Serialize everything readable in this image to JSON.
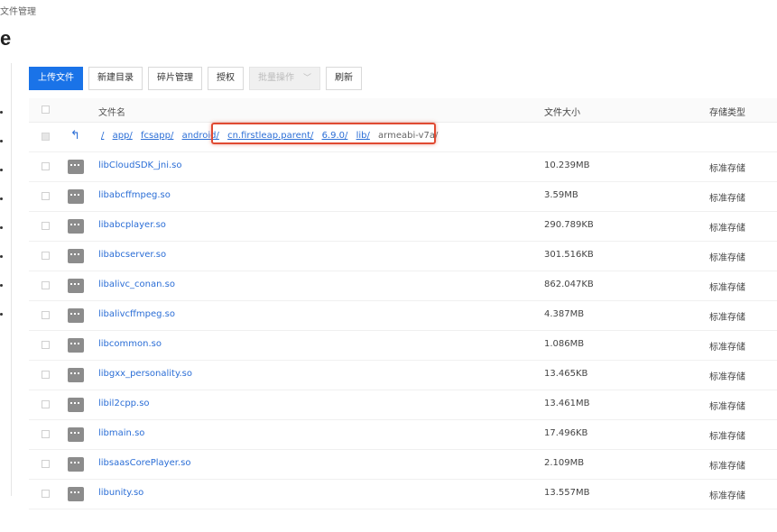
{
  "breadcrumb": "文件管理",
  "page_title_fragment": "e",
  "toolbar": {
    "upload": "上传文件",
    "new_dir": "新建目录",
    "fragments": "碎片管理",
    "authorize": "授权",
    "batch": "批量操作",
    "refresh": "刷新"
  },
  "columns": {
    "name": "文件名",
    "size": "文件大小",
    "type": "存储类型"
  },
  "path": {
    "segments": [
      "/",
      "app/",
      "fcsapp/",
      "android/",
      "cn.firstleap.parent/",
      "6.9.0/",
      "lib/"
    ],
    "current": "armeabi-v7a/"
  },
  "files": [
    {
      "name": "libCloudSDK_jni.so",
      "size": "10.239MB",
      "type": "标准存储"
    },
    {
      "name": "libabcffmpeg.so",
      "size": "3.59MB",
      "type": "标准存储"
    },
    {
      "name": "libabcplayer.so",
      "size": "290.789KB",
      "type": "标准存储"
    },
    {
      "name": "libabcserver.so",
      "size": "301.516KB",
      "type": "标准存储"
    },
    {
      "name": "libalivc_conan.so",
      "size": "862.047KB",
      "type": "标准存储"
    },
    {
      "name": "libalivcffmpeg.so",
      "size": "4.387MB",
      "type": "标准存储"
    },
    {
      "name": "libcommon.so",
      "size": "1.086MB",
      "type": "标准存储"
    },
    {
      "name": "libgxx_personality.so",
      "size": "13.465KB",
      "type": "标准存储"
    },
    {
      "name": "libil2cpp.so",
      "size": "13.461MB",
      "type": "标准存储"
    },
    {
      "name": "libmain.so",
      "size": "17.496KB",
      "type": "标准存储"
    },
    {
      "name": "libsaasCorePlayer.so",
      "size": "2.109MB",
      "type": "标准存储"
    },
    {
      "name": "libunity.so",
      "size": "13.557MB",
      "type": "标准存储"
    }
  ],
  "colors": {
    "primary": "#1a73e8",
    "link": "#2b6ed6",
    "highlight": "#e04a32"
  },
  "icons": {
    "back": "back-arrow-icon",
    "file": "file-icon",
    "dropdown": "chevron-down-icon"
  }
}
